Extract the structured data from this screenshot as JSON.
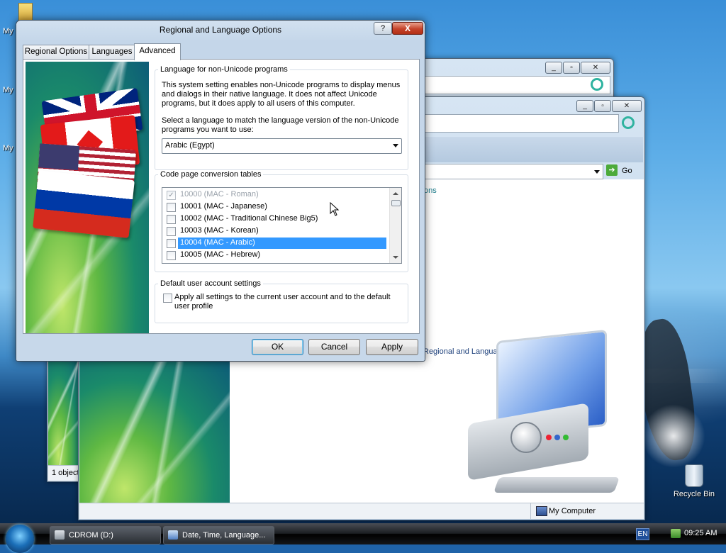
{
  "desktop": {
    "icon_labels": [
      "My",
      "My",
      "My"
    ],
    "recycle_bin": "Recycle Bin"
  },
  "bg_window_1": {
    "status": "1 object"
  },
  "bg_window_2": {
    "go_label": "Go",
    "link_suffix": "ons",
    "task_link": "Regional and Language Options",
    "status_computer": "My Computer"
  },
  "dialog": {
    "title": "Regional and Language Options",
    "help_glyph": "?",
    "close_glyph": "X",
    "tabs": [
      {
        "label": "Regional Options",
        "active": false
      },
      {
        "label": "Languages",
        "active": false
      },
      {
        "label": "Advanced",
        "active": true
      }
    ],
    "non_unicode": {
      "title": "Language for non-Unicode programs",
      "description": "This system setting enables non-Unicode programs to display menus and dialogs in their native language. It does not affect Unicode programs, but it does apply to all users of this computer.",
      "select_prompt": "Select a language to match the language version of the non-Unicode programs you want to use:",
      "selected_language": "Arabic (Egypt)"
    },
    "code_page": {
      "title": "Code page conversion tables",
      "items": [
        {
          "label": "10000 (MAC - Roman)",
          "checked": true,
          "disabled": true,
          "selected": false
        },
        {
          "label": "10001 (MAC - Japanese)",
          "checked": false,
          "disabled": false,
          "selected": false
        },
        {
          "label": "10002 (MAC - Traditional Chinese Big5)",
          "checked": false,
          "disabled": false,
          "selected": false
        },
        {
          "label": "10003 (MAC - Korean)",
          "checked": false,
          "disabled": false,
          "selected": false
        },
        {
          "label": "10004 (MAC - Arabic)",
          "checked": false,
          "disabled": false,
          "selected": true
        },
        {
          "label": "10005 (MAC - Hebrew)",
          "checked": false,
          "disabled": false,
          "selected": false
        }
      ]
    },
    "default_user": {
      "title": "Default user account settings",
      "checkbox_label": "Apply all settings to the current user account and to the default user profile",
      "checked": false
    },
    "buttons": {
      "ok": "OK",
      "cancel": "Cancel",
      "apply": "Apply"
    }
  },
  "taskbar": {
    "items": [
      {
        "label": "CDROM (D:)",
        "icon": "cdrom-icon"
      },
      {
        "label": "Date, Time, Language...",
        "icon": "control-panel-icon"
      }
    ],
    "language": "EN",
    "clock": "09:25 AM"
  }
}
